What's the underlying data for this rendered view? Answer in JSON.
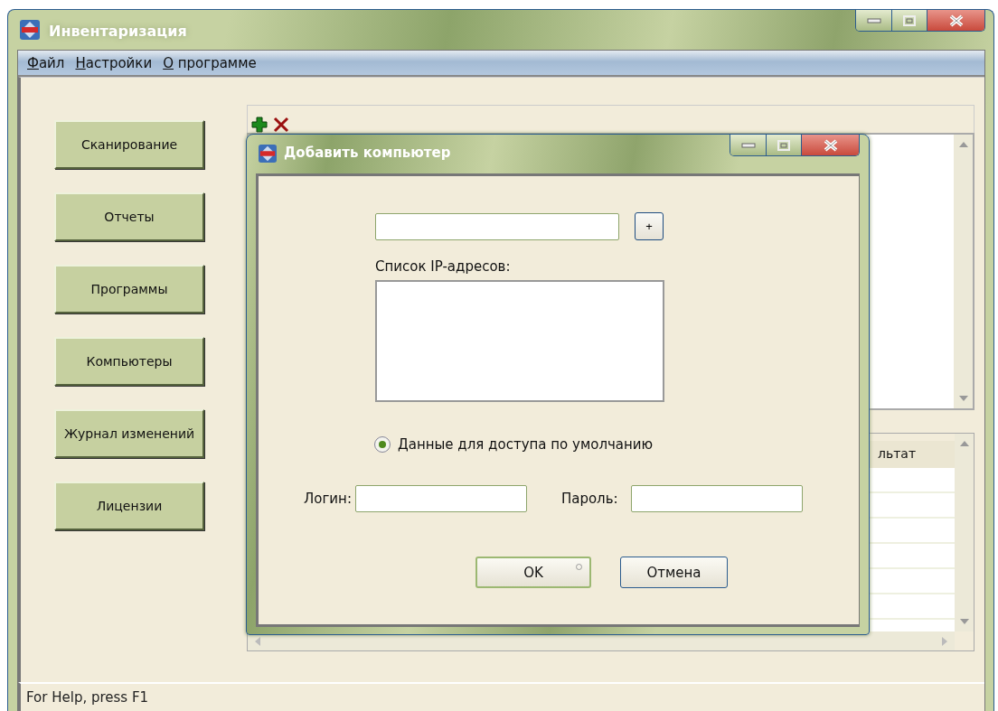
{
  "window": {
    "title": "Инвентаризация"
  },
  "menu": [
    {
      "label": "Файл"
    },
    {
      "label": "Настройки"
    },
    {
      "label": "О программе"
    }
  ],
  "nav_buttons": [
    "Сканирование",
    "Отчеты",
    "Программы",
    "Компьютеры",
    "Журнал изменений",
    "Лицензии"
  ],
  "results_table": {
    "columns": [
      "льтат"
    ]
  },
  "dialog": {
    "title": "Добавить компьютер",
    "add_button": "+",
    "ip_list_label": "Список IP-адресов:",
    "default_credentials": {
      "label": "Данные для доступа по умолчанию",
      "selected": true
    },
    "login_label": "Логин:",
    "password_label": "Пароль:",
    "buttons": [
      {
        "label": "OK",
        "default": true
      },
      {
        "label": "Отмена",
        "default": false
      }
    ]
  },
  "status_bar": "For Help, press F1"
}
